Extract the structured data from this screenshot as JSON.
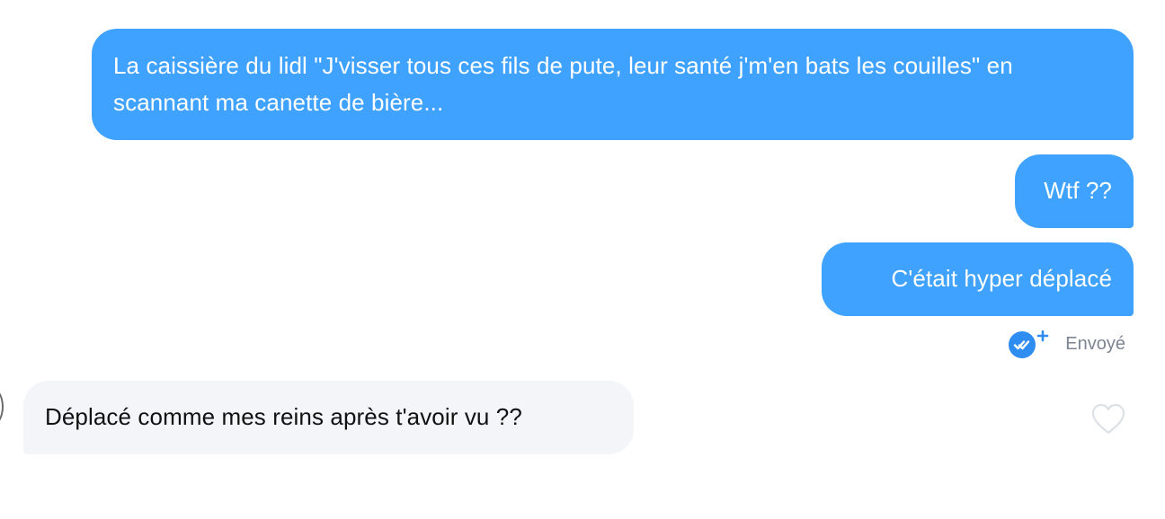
{
  "conversation": {
    "messages": [
      {
        "direction": "outgoing",
        "text": "La caissière du lidl \"J'visser tous ces fils de pute, leur santé j'm'en bats les couilles\" en scannant ma canette de bière..."
      },
      {
        "direction": "outgoing",
        "text": "Wtf ??"
      },
      {
        "direction": "outgoing",
        "text": "C'était hyper déplacé"
      },
      {
        "direction": "incoming",
        "text": "Déplacé comme mes reins après t'avoir vu ??"
      }
    ],
    "status": {
      "label": "Envoyé",
      "icon": "read-receipt-plus-icon"
    },
    "like_icon": "heart-outline-icon"
  },
  "colors": {
    "outgoing_bubble": "#3fa2ff",
    "incoming_bubble": "#f4f5f9",
    "status_icon": "#2f8cf0",
    "status_text": "#7c8591",
    "like_icon": "#dde1e6"
  }
}
